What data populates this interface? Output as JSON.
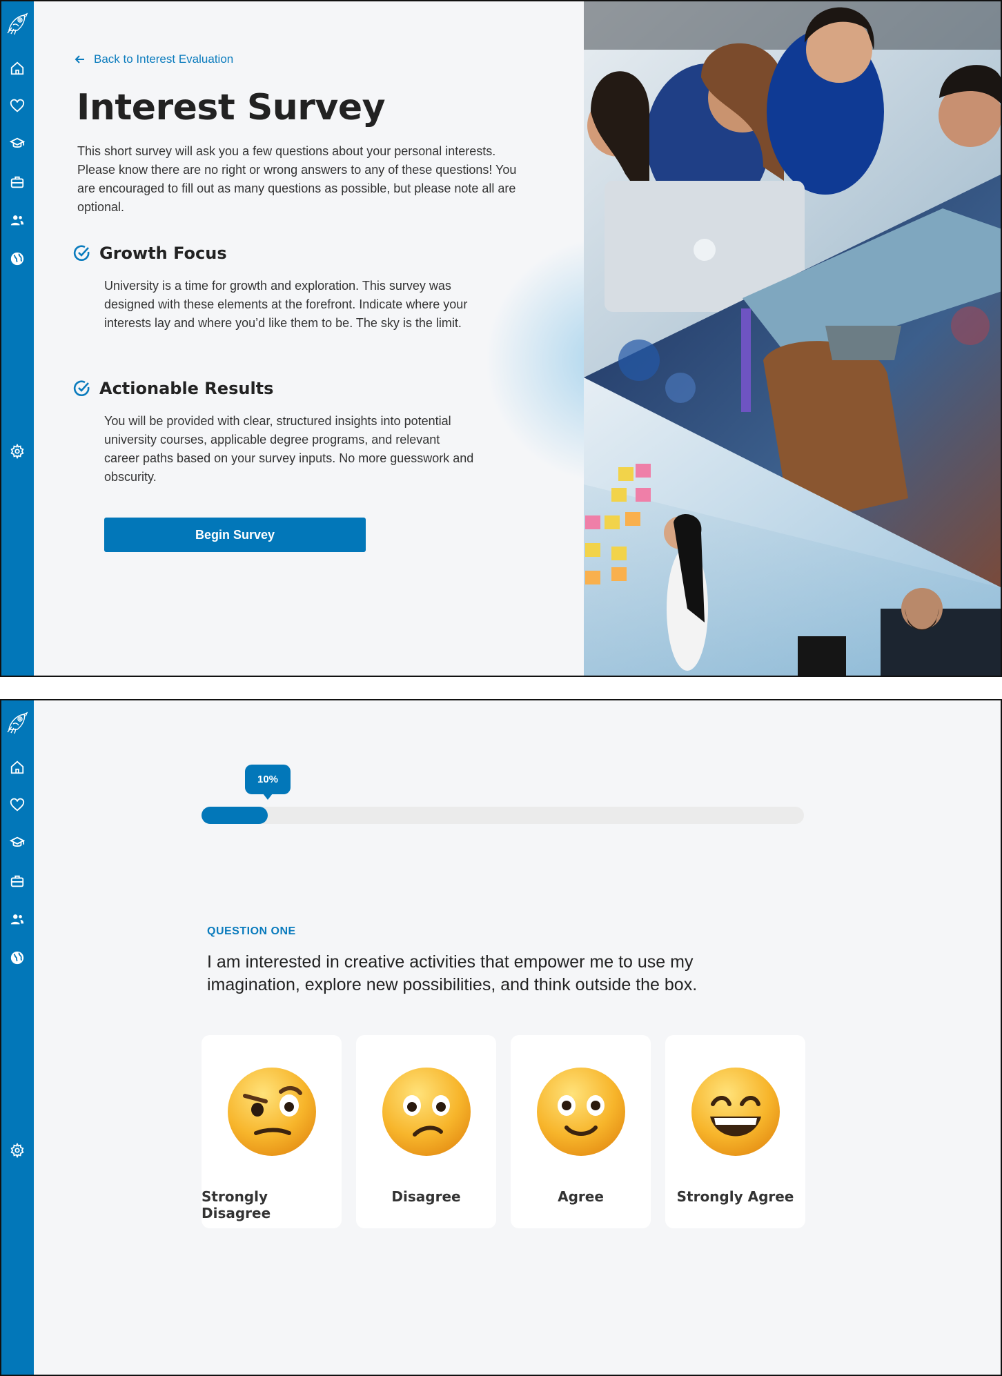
{
  "colors": {
    "brand": "#0277b9",
    "link": "#0a7bbd",
    "background": "#f5f6f8",
    "track": "#ebebeb"
  },
  "sidebar": {
    "logo": "owl-logo-icon",
    "items": [
      {
        "icon": "home-icon"
      },
      {
        "icon": "heart-icon"
      },
      {
        "icon": "graduation-cap-icon"
      },
      {
        "icon": "briefcase-icon"
      },
      {
        "icon": "people-icon"
      },
      {
        "icon": "globe-icon"
      },
      {
        "icon": "gear-icon"
      }
    ]
  },
  "intro_screen": {
    "back_link": "Back to Interest Evaluation",
    "title": "Interest Survey",
    "intro": "This short survey will ask you a few questions about your personal interests. Please know there are no right or wrong answers to any of these questions! You are encouraged to fill out as many questions as possible, but please note all are optional.",
    "features": [
      {
        "title": "Growth Focus",
        "body": "University is a time for growth and exploration. This survey was designed with these elements at the forefront. Indicate where your interests lay and where you’d like them to be. The sky is the limit."
      },
      {
        "title": "Actionable Results",
        "body": "You will be provided with clear, structured insights into potential university courses, applicable degree programs, and relevant career paths based on your survey inputs. No more guesswork and obscurity."
      }
    ],
    "cta": "Begin Survey"
  },
  "question_screen": {
    "progress": {
      "label": "10%",
      "fraction": 0.11
    },
    "question_label": "QUESTION ONE",
    "question_text": "I am interested in creative activities that empower me to use my imagination, explore new possibilities, and think outside the box.",
    "answers": [
      {
        "label": "Strongly Disagree",
        "icon": "skeptical-face-icon"
      },
      {
        "label": "Disagree",
        "icon": "confused-face-icon"
      },
      {
        "label": "Agree",
        "icon": "smiling-face-icon"
      },
      {
        "label": "Strongly Agree",
        "icon": "grinning-face-icon"
      }
    ]
  }
}
